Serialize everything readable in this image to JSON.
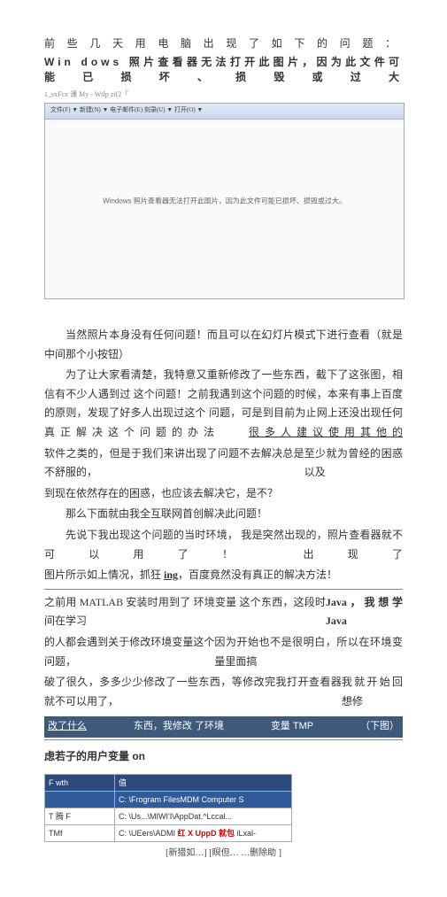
{
  "header": {
    "line1": "前些几天用电脑出现了如下的问题：",
    "line2": "Win dows 照片查看器无法打开此图片，因为此文件可能已损坏、损毁或过大"
  },
  "small_gray": "1_sxFcx 课 My - Wtlp zi(2「",
  "screenshot": {
    "toolbar": "文件(F) ▼  新建(N) ▼  电子邮件(E)  刻录(U) ▼  打开(O) ▼",
    "message": "Windows 照片查看器无法打开此图片，因为此文件可能已损坏、损毁或过大。"
  },
  "paragraphs": {
    "p1": "当然照片本身没有任何问题！而且可以在幻灯片模式下进行查看（就是中间那个小按钮）",
    "p2": "为了让大家看清楚，我特意又重新修改了一些东西，截下了这张图，相信有不少人遇到过 这个问题！之前我遇到这个问题的时候，本来有事上百度的原则，发现了好多人出现过这个 问题，可是到目前为止网上还没出现任何真正解决这个问题的办法",
    "p2_tail": "很多人建议使用其他的",
    "p3_a": "软件之类的，但是于我们来讲出现了问题不去解决总是不舒服的，",
    "p3_b": "至少就为曾经的困惑以及",
    "p4": "到现在依然存在的困惑，也应该去解决它，是不？",
    "p5": "那么下面就由我全互联网首创解决此问题！",
    "p6_a": "先说下我出现这个问题的当时环境，",
    "p6_b": "我是突然出现的，照片查看器就不可以用了！",
    "p6_c": "出现了",
    "p7_a": "图片所示如上情况，抓狂 ",
    "p7_b": "ing",
    "p7_c": "，百度竟然没有真正的解决方法！",
    "p8_a": "之前用 MATLAB 安装时用到了 环境变量 这个东西，这段时间在学习",
    "p8_b": "Java，我想学 Java",
    "p9_a": "的人都会遇到关于修改环境变量这个问题，",
    "p9_b": "因为开始也不是很明白，所以在环境变量里面搞",
    "p10_a": "破了很久，多多少少修改了一些东西，等修改完我打开查看器就不可以用了，",
    "p10_b": "我就开始回想修",
    "p11_a": "改了什么",
    "p11_b": "东西，我修改 了环境",
    "p11_c": "变量 TMP",
    "p11_d": "（下图）"
  },
  "env": {
    "title": "虑若子的用户变量 on",
    "columns": {
      "c1": "F wth",
      "c2": "值"
    },
    "rows": [
      {
        "name": "",
        "value": "C:  \\Frogram FilesMDM Computer S"
      },
      {
        "name": "T 腾 F",
        "value_pre": "C:  \\Us...\\MIWI'I\\AppDat.^Lccal...",
        "value": ""
      },
      {
        "name": "TMf",
        "value_pre": "C:  \\UEers\\ADMI ",
        "red": "红 X UppD 就包",
        "value_post": " iLxal-"
      }
    ],
    "buttons": "[新猎如…]   [瞑但…  …删除助  ]"
  }
}
